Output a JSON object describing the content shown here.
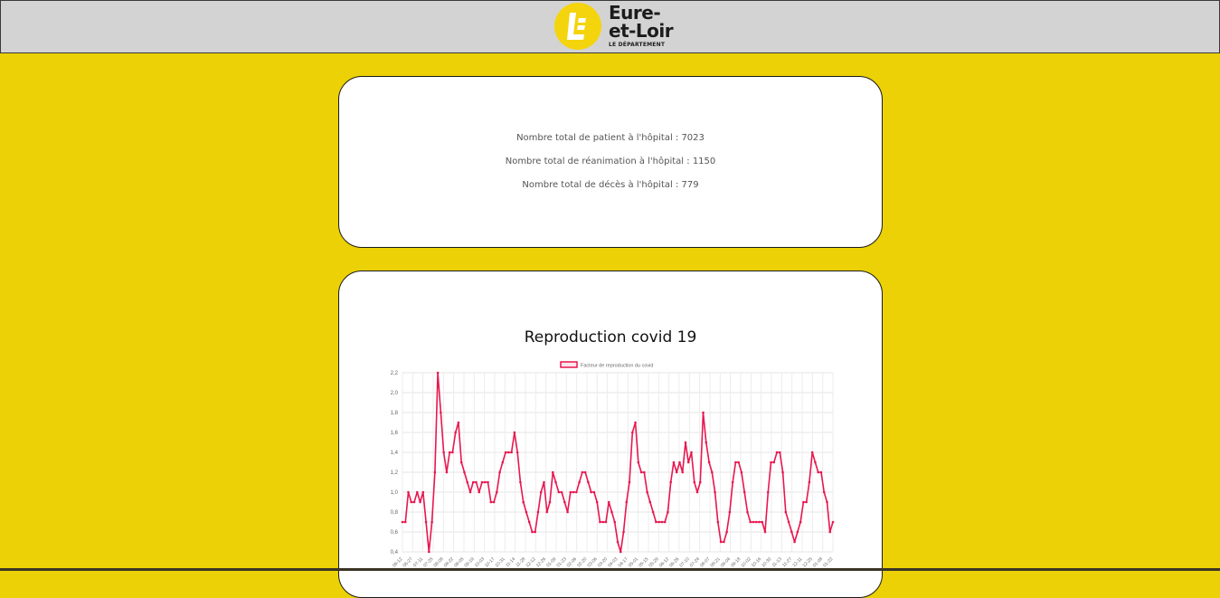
{
  "header": {
    "logo_line1": "Eure-",
    "logo_line2": "et-Loir",
    "logo_line3": "LE DÉPARTEMENT"
  },
  "stats": {
    "patients": "Nombre total de patient à l'hôpital : 7023",
    "reanimation": "Nombre total de réanimation à l'hôpital : 1150",
    "deces": "Nombre total de décès à l'hôpital : 779"
  },
  "colors": {
    "background": "#ebd105",
    "line": "#e8174f",
    "header": "#d3d3d3"
  },
  "chart_data": {
    "type": "line",
    "title": "Reproduction covid 19",
    "legend": "Facteur de reproduction du covid",
    "legend_position": "top",
    "grid": true,
    "ylim": [
      0.4,
      2.2
    ],
    "yticks": [
      "2,2",
      "2,0",
      "1,8",
      "1,6",
      "1,4",
      "1,2",
      "1,0",
      "0,8",
      "0,6",
      "0,4"
    ],
    "xticks": [
      "06-12",
      "06-27",
      "07-11",
      "07-25",
      "08-08",
      "08-22",
      "09-05",
      "09-19",
      "10-03",
      "10-17",
      "10-31",
      "11-14",
      "11-28",
      "12-12",
      "12-26",
      "01-09",
      "01-23",
      "02-06",
      "02-20",
      "03-06",
      "03-20",
      "04-03",
      "04-17",
      "05-01",
      "05-15",
      "05-29",
      "06-12",
      "06-26",
      "07-10",
      "07-24",
      "08-07",
      "08-21",
      "09-04",
      "09-18",
      "10-02",
      "10-16",
      "10-30",
      "11-13",
      "11-27",
      "12-11",
      "12-25",
      "01-08",
      "01-22"
    ],
    "series": [
      {
        "name": "Facteur de reproduction du covid",
        "values": [
          0.7,
          0.7,
          1.0,
          0.9,
          0.9,
          1.0,
          0.9,
          1.0,
          0.7,
          0.4,
          0.7,
          1.2,
          2.2,
          1.8,
          1.4,
          1.2,
          1.4,
          1.4,
          1.6,
          1.7,
          1.3,
          1.2,
          1.1,
          1.0,
          1.1,
          1.1,
          1.0,
          1.1,
          1.1,
          1.1,
          0.9,
          0.9,
          1.0,
          1.2,
          1.3,
          1.4,
          1.4,
          1.4,
          1.6,
          1.4,
          1.1,
          0.9,
          0.8,
          0.7,
          0.6,
          0.6,
          0.8,
          1.0,
          1.1,
          0.8,
          0.9,
          1.2,
          1.1,
          1.0,
          1.0,
          0.9,
          0.8,
          1.0,
          1.0,
          1.0,
          1.1,
          1.2,
          1.2,
          1.1,
          1.0,
          1.0,
          0.9,
          0.7,
          0.7,
          0.7,
          0.9,
          0.8,
          0.7,
          0.5,
          0.4,
          0.6,
          0.9,
          1.1,
          1.6,
          1.7,
          1.3,
          1.2,
          1.2,
          1.0,
          0.9,
          0.8,
          0.7,
          0.7,
          0.7,
          0.7,
          0.8,
          1.1,
          1.3,
          1.2,
          1.3,
          1.2,
          1.5,
          1.3,
          1.4,
          1.1,
          1.0,
          1.1,
          1.8,
          1.5,
          1.3,
          1.2,
          1.0,
          0.7,
          0.5,
          0.5,
          0.6,
          0.8,
          1.1,
          1.3,
          1.3,
          1.2,
          1.0,
          0.8,
          0.7,
          0.7,
          0.7,
          0.7,
          0.7,
          0.6,
          1.0,
          1.3,
          1.3,
          1.4,
          1.4,
          1.2,
          0.8,
          0.7,
          0.6,
          0.5,
          0.6,
          0.7,
          0.9,
          0.9,
          1.1,
          1.4,
          1.3,
          1.2,
          1.2,
          1.0,
          0.9,
          0.6,
          0.7
        ]
      }
    ]
  }
}
